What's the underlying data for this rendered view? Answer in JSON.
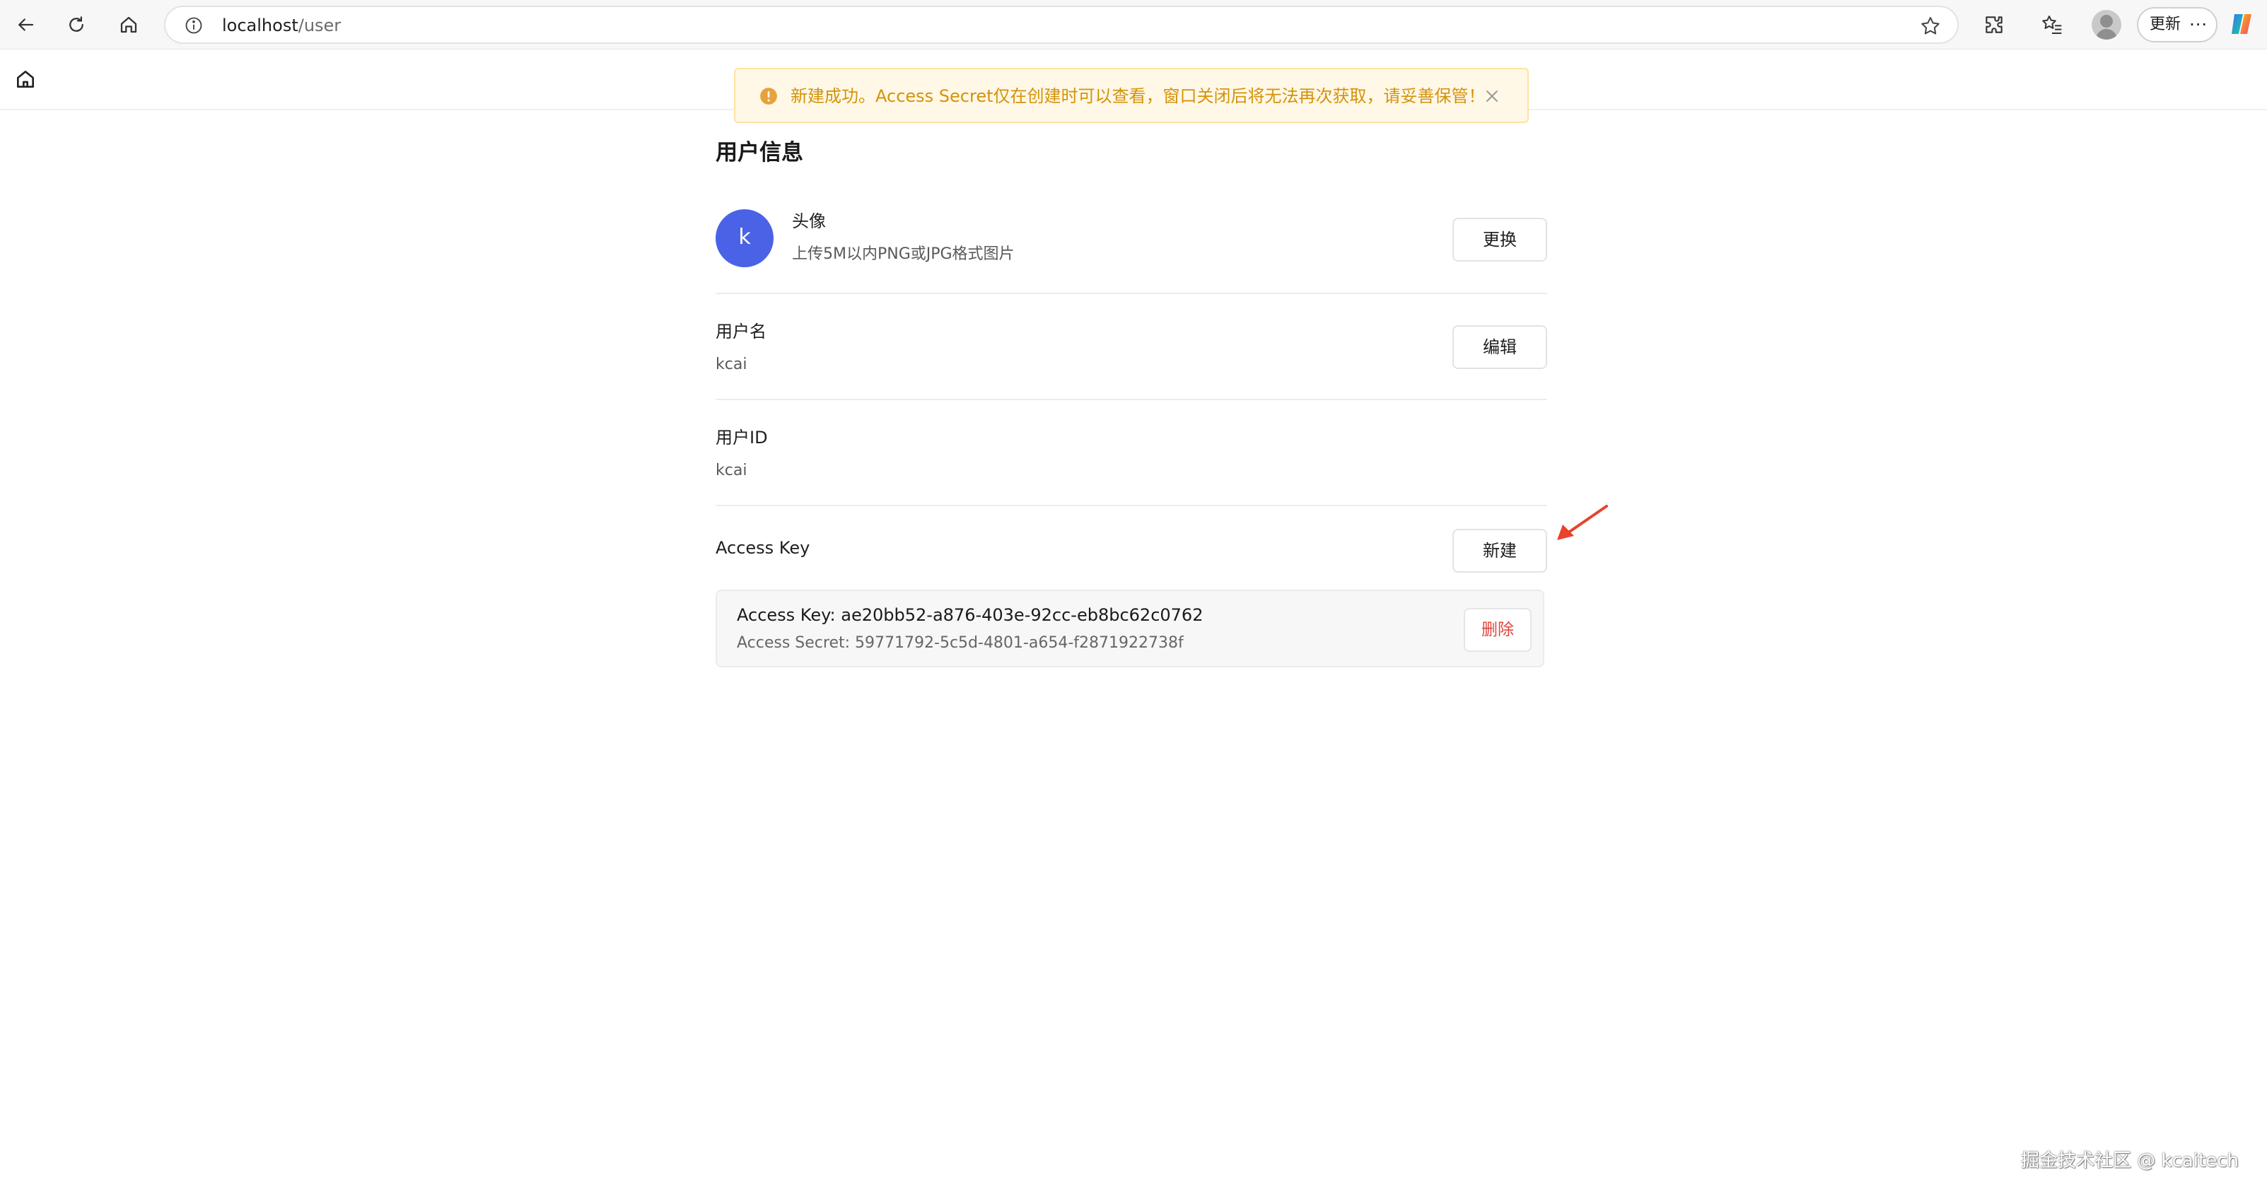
{
  "browser": {
    "url_host": "localhost",
    "url_path": "/user",
    "update_label": "更新",
    "more_label": "···",
    "icons": [
      "back-arrow-icon",
      "reload-icon",
      "home-icon",
      "info-icon",
      "star-icon",
      "extensions-icon",
      "favorites-icon",
      "profile-icon",
      "copilot-icon"
    ]
  },
  "toast": {
    "type": "warning",
    "message": "新建成功。Access Secret仅在创建时可以查看，窗口关闭后将无法再次获取，请妥善保管！",
    "color": "#d4920a"
  },
  "user_info": {
    "title": "用户信息",
    "avatar": {
      "label": "头像",
      "hint": "上传5M以内PNG或JPG格式图片",
      "initial": "k",
      "color": "#4a63e6",
      "button": "更换"
    },
    "username": {
      "label": "用户名",
      "value": "kcai",
      "button": "编辑"
    },
    "user_id": {
      "label": "用户ID",
      "value": "kcai"
    },
    "access_key": {
      "label": "Access Key",
      "button": "新建",
      "keys": [
        {
          "key_line": "Access Key: ae20bb52-a876-403e-92cc-eb8bc62c0762",
          "secret_line": "Access Secret: 59771792-5c5d-4801-a654-f2871922738f",
          "delete_label": "删除"
        }
      ]
    }
  },
  "watermark": "掘金技术社区 @ kcaitech"
}
